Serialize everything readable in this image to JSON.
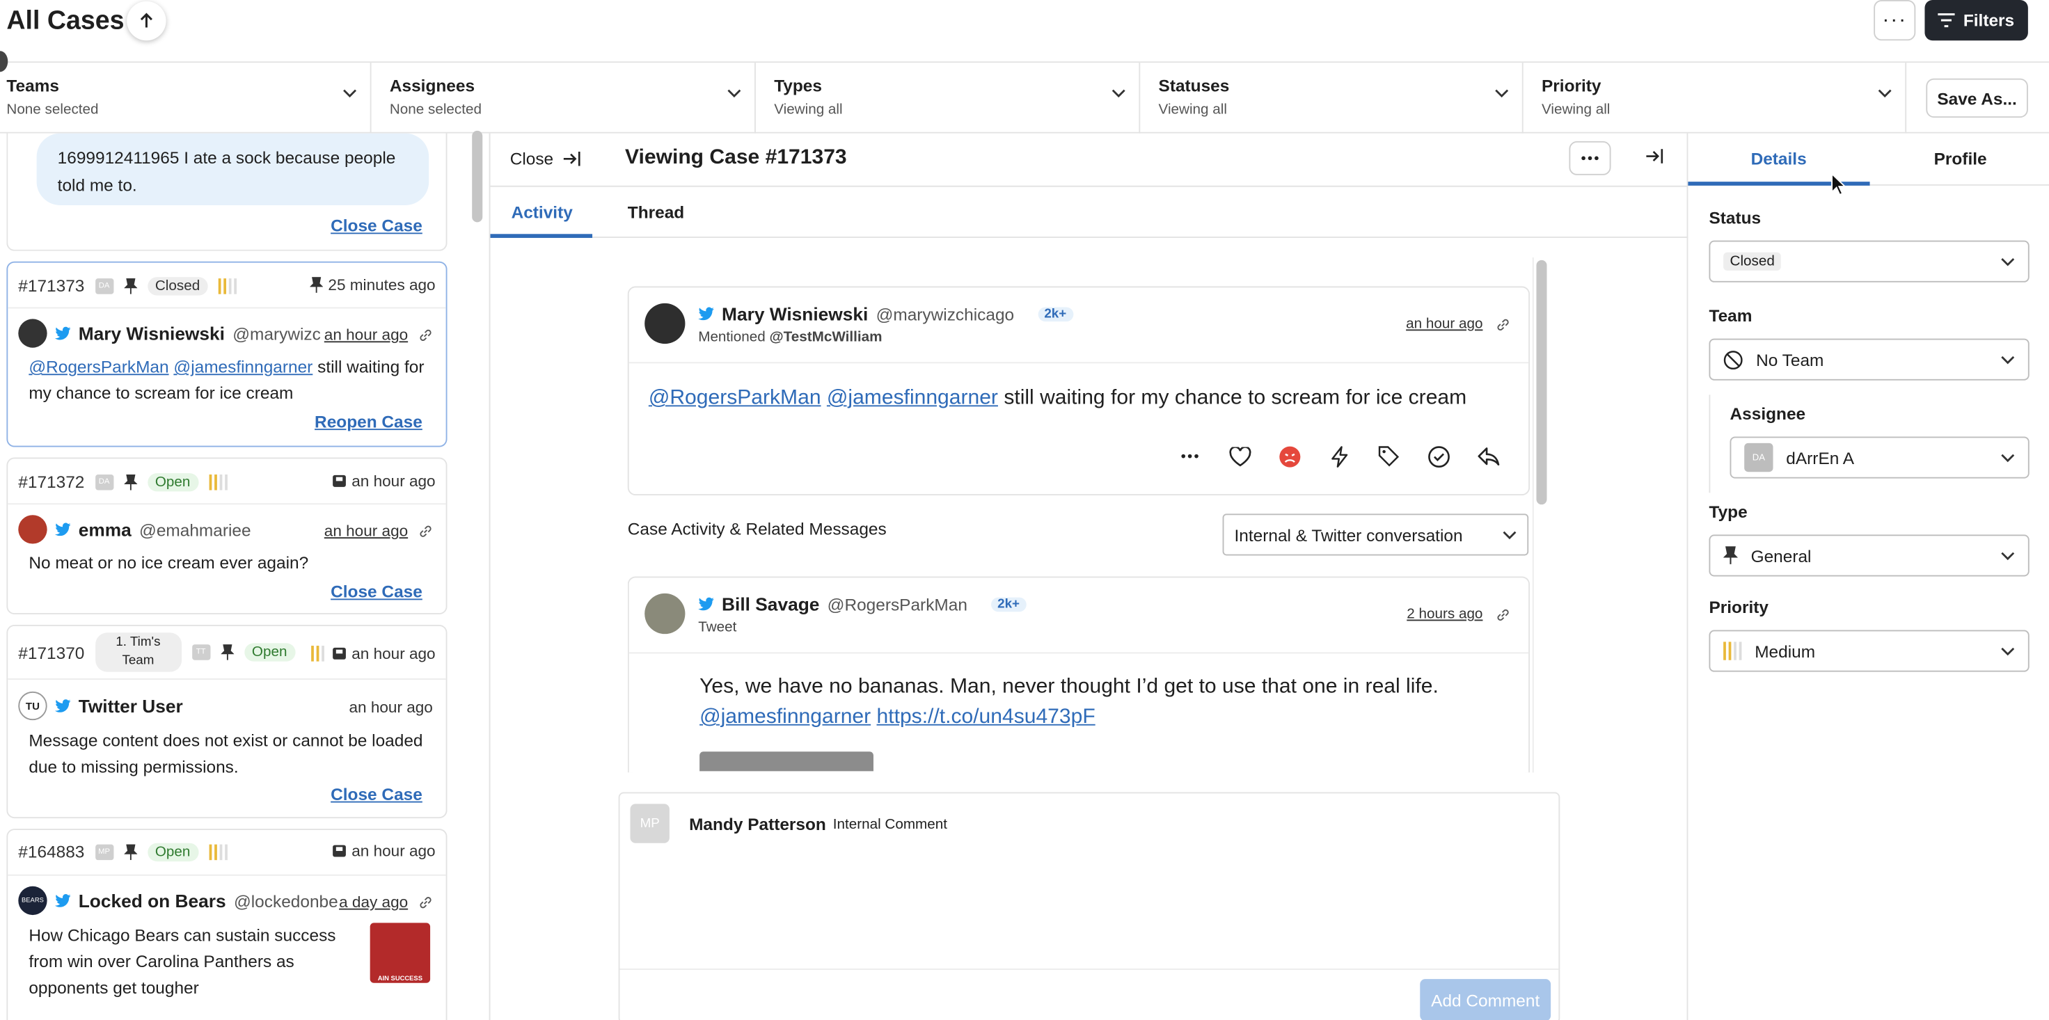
{
  "header": {
    "title": "All Cases",
    "filters_label": "Filters",
    "more_label": "···"
  },
  "filters": [
    {
      "title": "Teams",
      "sub": "None selected"
    },
    {
      "title": "Assignees",
      "sub": "None selected"
    },
    {
      "title": "Types",
      "sub": "Viewing all"
    },
    {
      "title": "Statuses",
      "sub": "Viewing all"
    },
    {
      "title": "Priority",
      "sub": "Viewing all"
    }
  ],
  "save_as": "Save As...",
  "cases": {
    "top": {
      "text": "1699912411965 I ate a sock because people told me to.",
      "link": "Close Case"
    },
    "c1": {
      "id": "#171373",
      "status": "Closed",
      "time": "25 minutes ago",
      "name": "Mary Wisniewski",
      "handle": "@marywizc",
      "rtime": "an hour ago",
      "m1": "@RogersParkMan",
      "m2": "@jamesfinngarner",
      "rest": " still waiting for my chance to scream for ice cream",
      "link": "Reopen Case"
    },
    "c2": {
      "id": "#171372",
      "status": "Open",
      "time": "an hour ago",
      "name": "emma",
      "handle": "@emahmariee",
      "rtime": "an hour ago",
      "text": "No meat or no ice cream ever again?",
      "link": "Close Case"
    },
    "c3": {
      "id": "#171370",
      "team": "1. Tim's Team",
      "status": "Open",
      "time": "an hour ago",
      "initials": "TU",
      "name": "Twitter User",
      "rtime": "an hour ago",
      "text": "Message content does not exist or cannot be loaded due to missing permissions.",
      "link": "Close Case"
    },
    "c4": {
      "id": "#164883",
      "status": "Open",
      "time": "an hour ago",
      "name": "Locked on Bears",
      "handle": "@lockedonbe",
      "rtime": "a day ago",
      "text": "How Chicago Bears can sustain success from win over Carolina Panthers as opponents get tougher",
      "avatar_text": "BEARS",
      "thumb_text": "AIN SUCCESS"
    }
  },
  "case_view": {
    "close": "Close",
    "title": "Viewing Case #171373",
    "tabs": [
      "Activity",
      "Thread"
    ],
    "post1": {
      "name": "Mary Wisniewski",
      "handle": "@marywizchicago",
      "badge": "2k+",
      "sub_prefix": "Mentioned",
      "sub_handle": "@TestMcWilliam",
      "time": "an hour ago",
      "m1": "@RogersParkMan",
      "m2": "@jamesfinngarner",
      "rest": "still waiting for my chance to scream for ice cream"
    },
    "related_label": "Case Activity & Related Messages",
    "related_select": "Internal & Twitter conversation",
    "post2": {
      "name": "Bill Savage",
      "handle": "@RogersParkMan",
      "badge": "2k+",
      "sub": "Tweet",
      "time": "2 hours ago",
      "text": "Yes, we have no bananas. Man, never thought I’d get to use that one in real life.",
      "m1": "@jamesfinngarner",
      "link": "https://t.co/un4su473pF"
    },
    "composer": {
      "initials": "MP",
      "name": "Mandy Patterson",
      "type": "Internal Comment",
      "button": "Add Comment"
    }
  },
  "details": {
    "tabs": [
      "Details",
      "Profile"
    ],
    "status_label": "Status",
    "status_value": "Closed",
    "team_label": "Team",
    "team_value": "No Team",
    "assignee_label": "Assignee",
    "assignee_value": "dArrEn A",
    "assignee_initials": "DA",
    "type_label": "Type",
    "type_value": "General",
    "priority_label": "Priority",
    "priority_value": "Medium"
  },
  "colors": {
    "accent": "#2f6bb8",
    "dark_button": "#23272e",
    "bubble": "#e6f1fb",
    "priority": "#e9b93a"
  }
}
